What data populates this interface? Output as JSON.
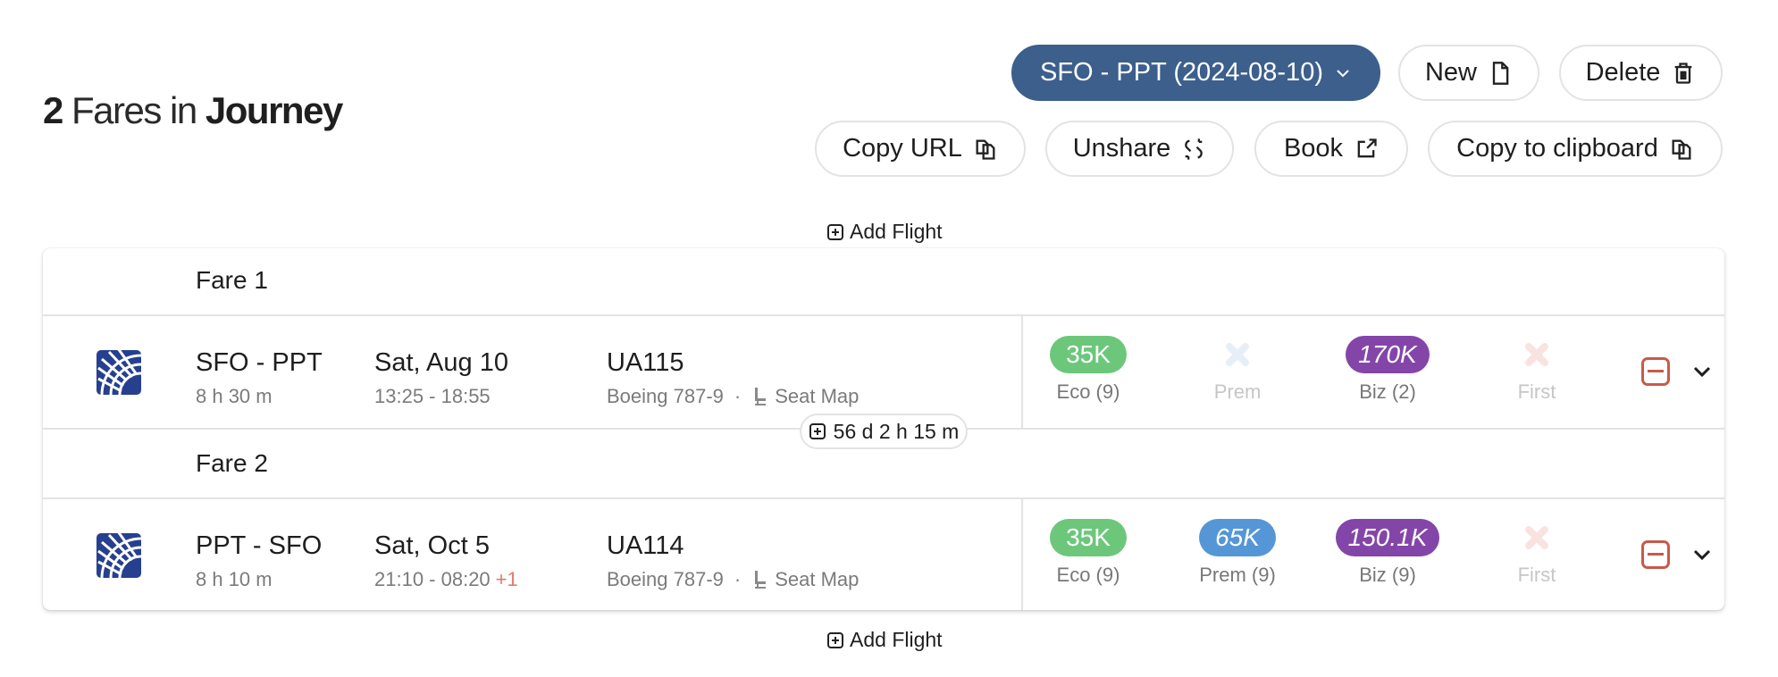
{
  "header": {
    "count": "2",
    "middle": "Fares in",
    "bold_word": "Journey"
  },
  "toolbar": {
    "journey_select": "SFO - PPT (2024-08-10)",
    "new_label": "New",
    "delete_label": "Delete",
    "copy_url_label": "Copy URL",
    "unshare_label": "Unshare",
    "book_label": "Book",
    "copy_clipboard_label": "Copy to clipboard"
  },
  "add_flight_label": "Add Flight",
  "colors": {
    "primary": "#3c5f8c",
    "eco": "#6cc77b",
    "prem": "#5596d6",
    "biz": "#8445a8",
    "remove": "#c9594a",
    "unavailable_prem": "#e6eff8",
    "unavailable_first": "#f9e3e1"
  },
  "fares": [
    {
      "label": "Fare 1",
      "airline_icon": "united-airlines-globe",
      "route": "SFO - PPT",
      "duration": "8 h 30 m",
      "date": "Sat, Aug 10",
      "times": "13:25 - 18:55",
      "day_offset": "",
      "flight_no": "UA115",
      "aircraft": "Boeing 787-9",
      "separator": "·",
      "seat_map_label": "Seat Map",
      "classes": [
        {
          "name": "Eco",
          "label": "Eco (9)",
          "price": "35K",
          "available": true
        },
        {
          "name": "Prem",
          "label": "Prem",
          "price": "",
          "available": false
        },
        {
          "name": "Biz",
          "label": "Biz (2)",
          "price": "170K",
          "available": true
        },
        {
          "name": "First",
          "label": "First",
          "price": "",
          "available": false
        }
      ]
    },
    {
      "label": "Fare 2",
      "airline_icon": "united-airlines-globe",
      "route": "PPT - SFO",
      "duration": "8 h 10 m",
      "date": "Sat, Oct 5",
      "times": "21:10 - 08:20",
      "day_offset": "+1",
      "flight_no": "UA114",
      "aircraft": "Boeing 787-9",
      "separator": "·",
      "seat_map_label": "Seat Map",
      "classes": [
        {
          "name": "Eco",
          "label": "Eco (9)",
          "price": "35K",
          "available": true
        },
        {
          "name": "Prem",
          "label": "Prem (9)",
          "price": "65K",
          "available": true
        },
        {
          "name": "Biz",
          "label": "Biz (9)",
          "price": "150.1K",
          "available": true
        },
        {
          "name": "First",
          "label": "First",
          "price": "",
          "available": false
        }
      ]
    }
  ],
  "layover": "56 d 2 h 15 m"
}
